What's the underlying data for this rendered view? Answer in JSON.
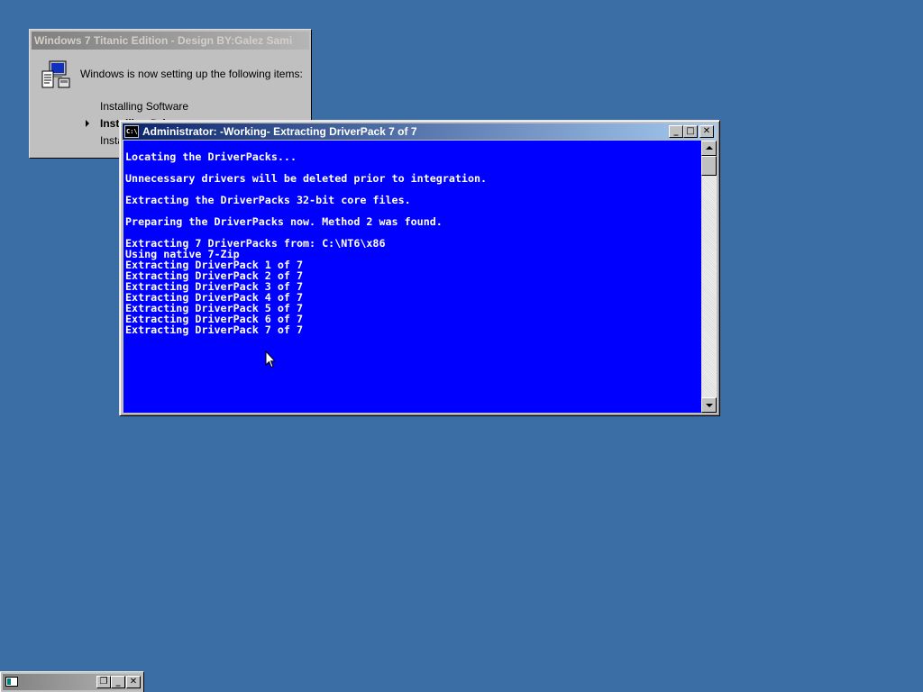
{
  "setup_dialog": {
    "title": "Windows 7 Titanic Edition - Design BY:Galez Sami",
    "heading": "Windows is now setting up the following items:",
    "items": [
      {
        "label": "Installing Software"
      },
      {
        "label": "Installing Drivers"
      },
      {
        "label": "Installing Updates"
      }
    ]
  },
  "console": {
    "title": "Administrator:  -Working- Extracting DriverPack 7 of 7",
    "icon_label": "C:\\",
    "lines": [
      "",
      "Locating the DriverPacks...",
      "",
      "Unnecessary drivers will be deleted prior to integration.",
      "",
      "Extracting the DriverPacks 32-bit core files.",
      "",
      "Preparing the DriverPacks now. Method 2 was found.",
      "",
      "Extracting 7 DriverPacks from: C:\\NT6\\x86",
      "Using native 7-Zip",
      "Extracting DriverPack 1 of 7",
      "Extracting DriverPack 2 of 7",
      "Extracting DriverPack 3 of 7",
      "Extracting DriverPack 4 of 7",
      "Extracting DriverPack 5 of 7",
      "Extracting DriverPack 6 of 7",
      "Extracting DriverPack 7 of 7"
    ],
    "buttons": {
      "minimize": "_",
      "maximize": "□",
      "close": "✕"
    }
  },
  "minimized_window": {
    "buttons": {
      "restore": "❐",
      "minimize": "_",
      "close": "✕"
    }
  },
  "colors": {
    "desktop": "#3a6ea5",
    "console_bg": "#0000ff",
    "console_text": "#ffffff",
    "active_title": "#0a246a",
    "inactive_title": "#808080"
  }
}
